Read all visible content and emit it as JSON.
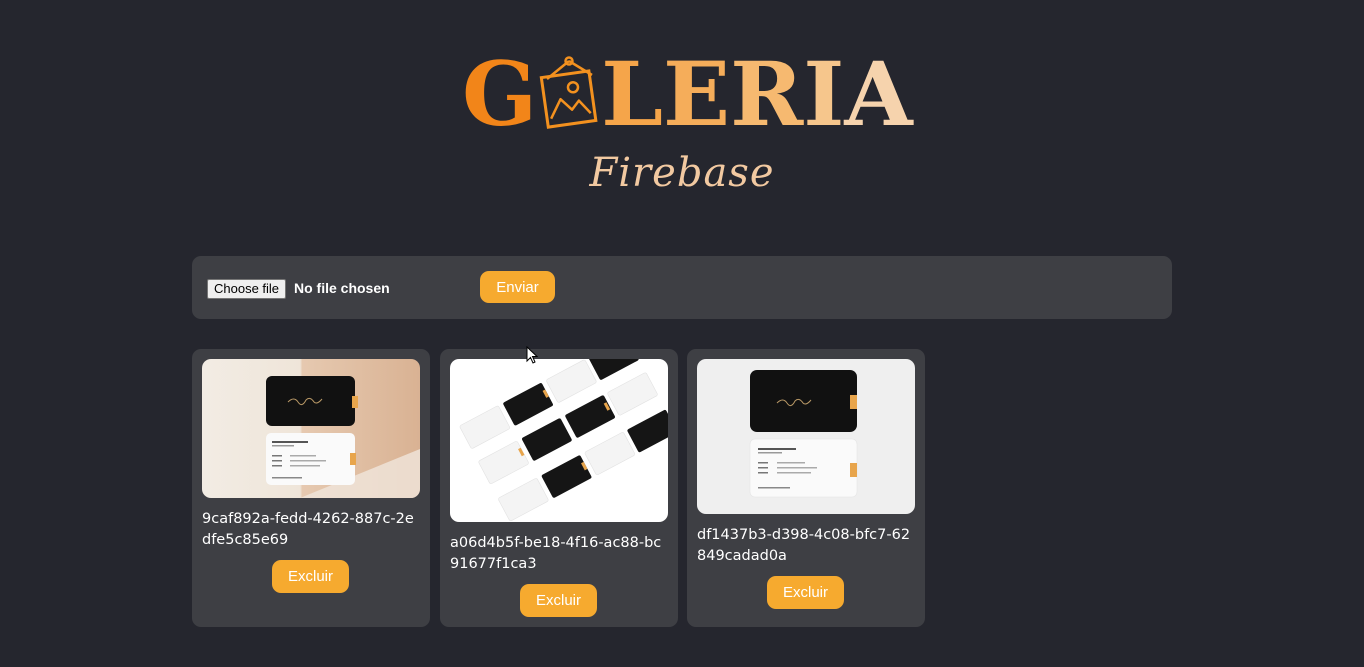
{
  "logo": {
    "letter_first": "G",
    "letters_rest": [
      "L",
      "E",
      "R",
      "I",
      "A"
    ],
    "colors": [
      "#f28519",
      "#f3901f",
      "#f5a54a",
      "#f6b56a",
      "#f6c487",
      "#f6d3ad"
    ],
    "frame_icon": "picture-frame-icon"
  },
  "subtitle": "Firebase",
  "upload": {
    "choose_label": "Choose file",
    "status": "No file chosen",
    "send_label": "Enviar"
  },
  "images": [
    {
      "name": "9caf892a-fedd-4262-887c-2edfe5c85e69",
      "delete_label": "Excluir",
      "image_icon": "business-card-mockup"
    },
    {
      "name": "a06d4b5f-be18-4f16-ac88-bc91677f1ca3",
      "delete_label": "Excluir",
      "image_icon": "business-card-grid-mockup"
    },
    {
      "name": "df1437b3-d398-4c08-bfc7-62849cadad0a",
      "delete_label": "Excluir",
      "image_icon": "business-card-mockup"
    }
  ],
  "theme": {
    "background": "#25262e",
    "panel": "#3e3f44",
    "accent": "#f6aa2f"
  }
}
